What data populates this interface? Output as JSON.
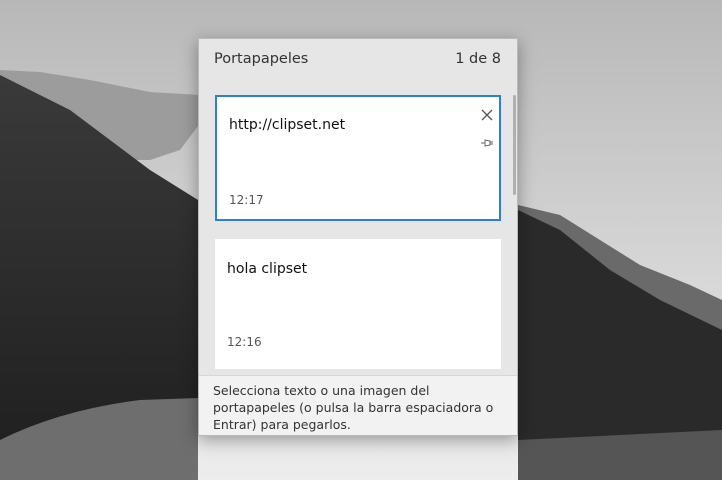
{
  "clipboard": {
    "title": "Portapapeles",
    "counter": "1 de 8",
    "items": [
      {
        "text": "http://clipset.net",
        "time": "12:17"
      },
      {
        "text": "hola clipset",
        "time": "12:16"
      }
    ],
    "hint": "Selecciona texto o una imagen del portapapeles (o pulsa la barra espaciadora o Entrar) para pegarlos."
  },
  "colors": {
    "accent": "#2b7fd4",
    "panel_bg": "#e6e6e6",
    "card_bg": "#ffffff"
  },
  "icons": [
    "close-icon",
    "pin-icon"
  ]
}
